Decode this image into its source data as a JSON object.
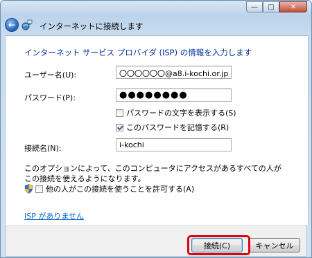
{
  "window": {
    "title": "インターネットに接続します",
    "controls": [
      "minimize-icon",
      "maximize-icon",
      "close-icon"
    ]
  },
  "heading": "インターネット サービス プロバイダ (ISP) の情報を入力します",
  "form": {
    "username": {
      "label": "ユーザー名(U):",
      "value": "〇〇〇〇〇〇@a8.i-kochi.or.jp"
    },
    "password": {
      "label": "パスワード(P):",
      "value": "●●●●●●●●"
    },
    "show_password": {
      "label": "パスワードの文字を表示する(S)",
      "checked": false
    },
    "remember_password": {
      "label": "このパスワードを記憶する(R)",
      "checked": true
    },
    "connection_name": {
      "label": "接続名(N):",
      "value": "i-kochi"
    }
  },
  "note": "このオプションによって、このコンピュータにアクセスがあるすべての人がこの接続を使えるようになります。",
  "allow_others": {
    "label": "他の人がこの接続を使うことを許可する(A)",
    "checked": false
  },
  "no_isp_link": "ISP がありません",
  "buttons": {
    "connect": "接続(C)",
    "cancel": "キャンセル"
  },
  "colors": {
    "heading": "#003399",
    "link": "#0066cc",
    "highlight": "#e00012"
  }
}
